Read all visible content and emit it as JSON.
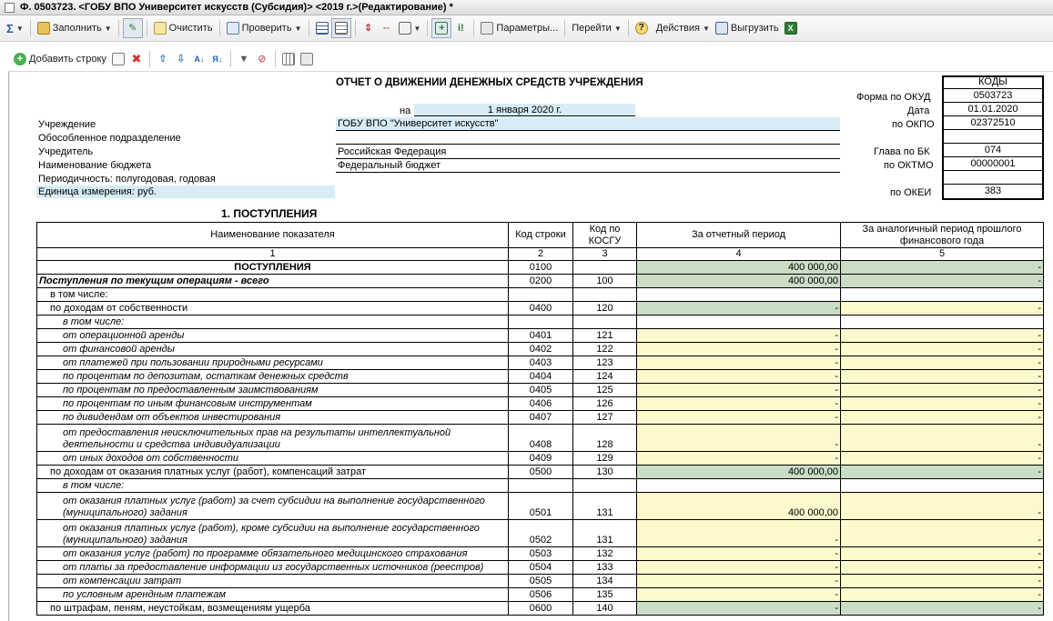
{
  "window": {
    "title": "Ф. 0503723. <ГОБУ ВПО Университет искусств (Субсидия)> <2019 г.>(Редактирование) *"
  },
  "toolbar": {
    "sum_label": "Σ",
    "fill_label": "Заполнить",
    "clear_label": "Очистить",
    "check_label": "Проверить",
    "params_label": "Параметры...",
    "goto_label": "Перейти",
    "help_label": "?",
    "actions_label": "Действия",
    "export_label": "Выгрузить"
  },
  "toolbar2": {
    "add_row_label": "Добавить строку"
  },
  "header": {
    "report_title": "ОТЧЕТ О ДВИЖЕНИИ ДЕНЕЖНЫХ СРЕДСТВ УЧРЕЖДЕНИЯ",
    "on_label": "на",
    "date_value": "1 января 2020 г.",
    "institution_label": "Учреждение",
    "institution_value": "ГОБУ ВПО \"Университет искусств\"",
    "subdivision_label": "Обособленное подразделение",
    "founder_label": "Учредитель",
    "founder_value": "Российская Федерация",
    "budget_label": "Наименование бюджета",
    "budget_value": "Федеральный бюджет",
    "periodicity_label": "Периодичность: полугодовая, годовая",
    "unit_label": "Единица измерения: руб.",
    "codes_title": "КОДЫ",
    "okud_label": "Форма по ОКУД",
    "okud_value": "0503723",
    "date_label": "Дата",
    "date_code": "01.01.2020",
    "okpo_label": "по ОКПО",
    "okpo_value": "02372510",
    "bk_label": "Глава по БК",
    "bk_value": "074",
    "oktmo_label": "по ОКТМО",
    "oktmo_value": "00000001",
    "okei_label": "по ОКЕИ",
    "okei_value": "383"
  },
  "section": {
    "title": "1. ПОСТУПЛЕНИЯ"
  },
  "table": {
    "columns": [
      "Наименование показателя",
      "Код строки",
      "Код по КОСГУ",
      "За отчетный период",
      "За аналогичный период прошлого финансового года"
    ],
    "column_numbers": [
      "1",
      "2",
      "3",
      "4",
      "5"
    ],
    "rows": [
      {
        "name": "ПОСТУПЛЕНИЯ",
        "code": "0100",
        "kosgu": "",
        "current": "400 000,00",
        "previous": "-"
      },
      {
        "name": "Поступления по текущим операциям - всего",
        "code": "0200",
        "kosgu": "100",
        "current": "400 000,00",
        "previous": "-"
      },
      {
        "name": "в том числе:",
        "code": "",
        "kosgu": "",
        "current": "",
        "previous": ""
      },
      {
        "name": "по доходам от собственности",
        "code": "0400",
        "kosgu": "120",
        "current": "-",
        "previous": "-"
      },
      {
        "name": "в том числе:",
        "code": "",
        "kosgu": "",
        "current": "",
        "previous": ""
      },
      {
        "name": "от операционной аренды",
        "code": "0401",
        "kosgu": "121",
        "current": "-",
        "previous": "-"
      },
      {
        "name": "от финансовой аренды",
        "code": "0402",
        "kosgu": "122",
        "current": "-",
        "previous": "-"
      },
      {
        "name": "от платежей при пользовании природными ресурсами",
        "code": "0403",
        "kosgu": "123",
        "current": "-",
        "previous": "-"
      },
      {
        "name": "по процентам по депозитам, остаткам денежных средств",
        "code": "0404",
        "kosgu": "124",
        "current": "-",
        "previous": "-"
      },
      {
        "name": "по процентам по предоставленным заимствованиям",
        "code": "0405",
        "kosgu": "125",
        "current": "-",
        "previous": "-"
      },
      {
        "name": "по процентам по иным финансовым инструментам",
        "code": "0406",
        "kosgu": "126",
        "current": "-",
        "previous": "-"
      },
      {
        "name": "по дивидендам от объектов инвестирования",
        "code": "0407",
        "kosgu": "127",
        "current": "-",
        "previous": "-"
      },
      {
        "name": "от предоставления неисключительных прав на результаты интеллектуальной деятельности и средства индивидуализации",
        "code": "0408",
        "kosgu": "128",
        "current": "-",
        "previous": "-"
      },
      {
        "name": "от иных доходов от собственности",
        "code": "0409",
        "kosgu": "129",
        "current": "-",
        "previous": "-"
      },
      {
        "name": "по доходам от оказания платных услуг (работ), компенсаций затрат",
        "code": "0500",
        "kosgu": "130",
        "current": "400 000,00",
        "previous": "-"
      },
      {
        "name": "в том числе:",
        "code": "",
        "kosgu": "",
        "current": "",
        "previous": ""
      },
      {
        "name": "от оказания платных услуг (работ) за счет субсидии на выполнение государственного (муниципального) задания",
        "code": "0501",
        "kosgu": "131",
        "current": "400 000,00",
        "previous": "-"
      },
      {
        "name": "от оказания платных услуг (работ), кроме субсидии на выполнение государственного (муниципального) задания",
        "code": "0502",
        "kosgu": "131",
        "current": "-",
        "previous": "-"
      },
      {
        "name": "от оказания услуг (работ) по программе обязательного медицинского страхования",
        "code": "0503",
        "kosgu": "132",
        "current": "-",
        "previous": "-"
      },
      {
        "name": "от платы за предоставление информации из государственных источников (реестров)",
        "code": "0504",
        "kosgu": "133",
        "current": "-",
        "previous": "-"
      },
      {
        "name": "от компенсации затрат",
        "code": "0505",
        "kosgu": "134",
        "current": "-",
        "previous": "-"
      },
      {
        "name": "по условным арендным платежам",
        "code": "0506",
        "kosgu": "135",
        "current": "-",
        "previous": "-"
      },
      {
        "name": "по штрафам, пеням, неустойкам, возмещениям ущерба",
        "code": "0600",
        "kosgu": "140",
        "current": "-",
        "previous": "-"
      }
    ]
  }
}
